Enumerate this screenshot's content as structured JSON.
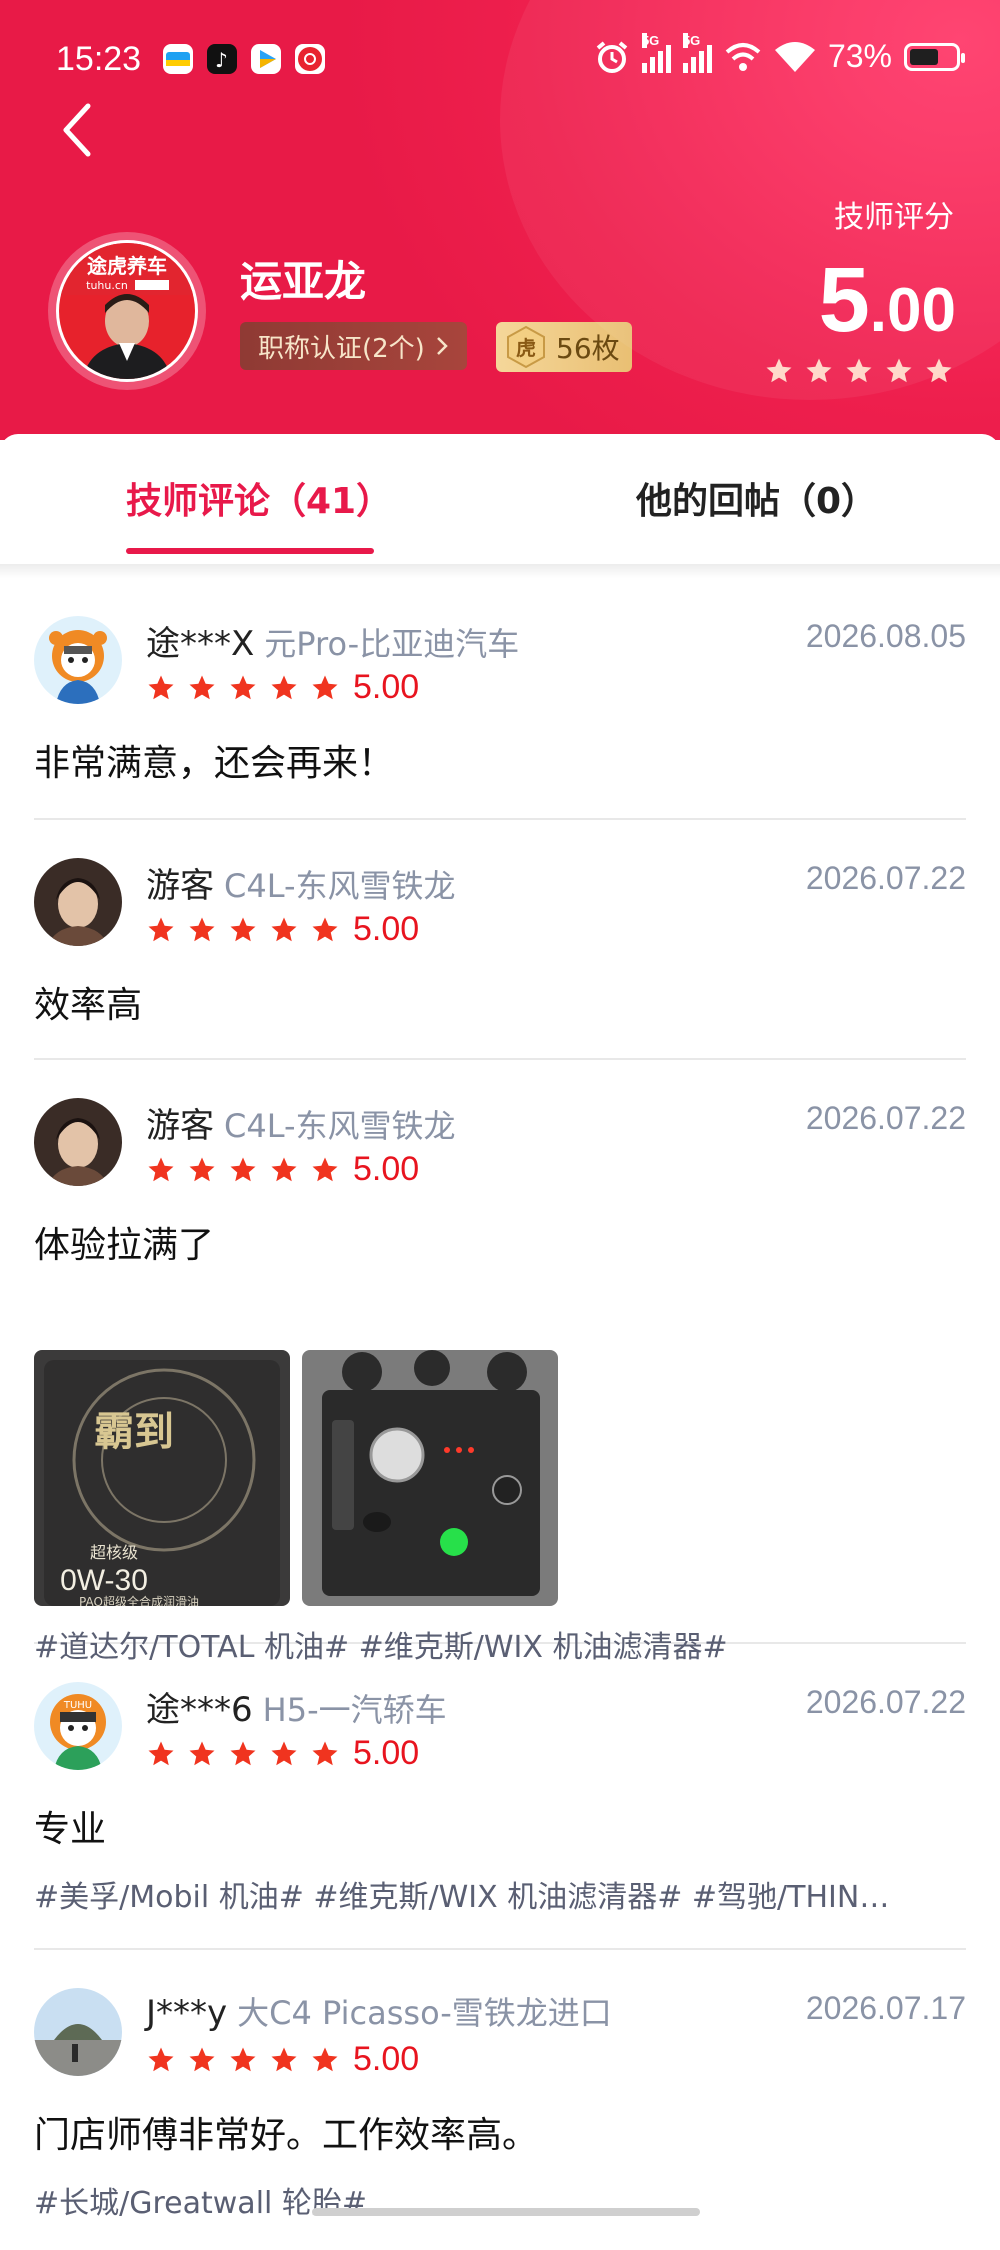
{
  "status_bar": {
    "time": "15:23",
    "battery_percent": "73%",
    "network_tag_1": "5G",
    "network_tag_2": "5G"
  },
  "header": {
    "technician_name": "运亚龙",
    "avatar_brand": "途虎养车",
    "avatar_domain": "tuhu.cn",
    "certification_label": "职称认证(2个)",
    "badge_icon_text": "虎",
    "badge_count": "56枚",
    "score_label": "技师评分",
    "score_int": "5",
    "score_dec": ".00",
    "score_stars": 5
  },
  "tabs": [
    {
      "label": "技师评论（41）",
      "active": true
    },
    {
      "label": "他的回帖（0）",
      "active": false
    }
  ],
  "reviews": [
    {
      "user": "途***X",
      "car": "元Pro-比亚迪汽车",
      "date": "2026.08.05",
      "rating": "5.00",
      "stars": 5,
      "text": "非常满意，还会再来！",
      "tags": ""
    },
    {
      "user": "游客",
      "car": "C4L-东风雪铁龙",
      "date": "2026.07.22",
      "rating": "5.00",
      "stars": 5,
      "text": "效率高",
      "tags": ""
    },
    {
      "user": "游客",
      "car": "C4L-东风雪铁龙",
      "date": "2026.07.22",
      "rating": "5.00",
      "stars": 5,
      "text": "体验拉满了",
      "tags": "#道达尔/TOTAL 机油# #维克斯/WIX 机油滤清器#",
      "photo1_text_a": "霸到",
      "photo1_text_b": "超核级",
      "photo1_text_c": "0W-30",
      "photo1_text_d": "PAO超级全合成润滑油"
    },
    {
      "user": "途***6",
      "car": "H5-一汽轿车",
      "date": "2026.07.22",
      "rating": "5.00",
      "stars": 5,
      "text": "专业",
      "tags": "#美孚/Mobil 机油# #维克斯/WIX 机油滤清器# #驾驰/THIN…"
    },
    {
      "user": "J***y",
      "car": "大C4 Picasso-雪铁龙进口",
      "date": "2026.07.17",
      "rating": "5.00",
      "stars": 5,
      "text": "门店师傅非常好。工作效率高。",
      "tags": "#长城/Greatwall 轮胎#"
    }
  ],
  "colors": {
    "accent": "#e8194a",
    "star": "#f0341f",
    "score_red": "#e8141f",
    "muted": "#8a93a6"
  }
}
